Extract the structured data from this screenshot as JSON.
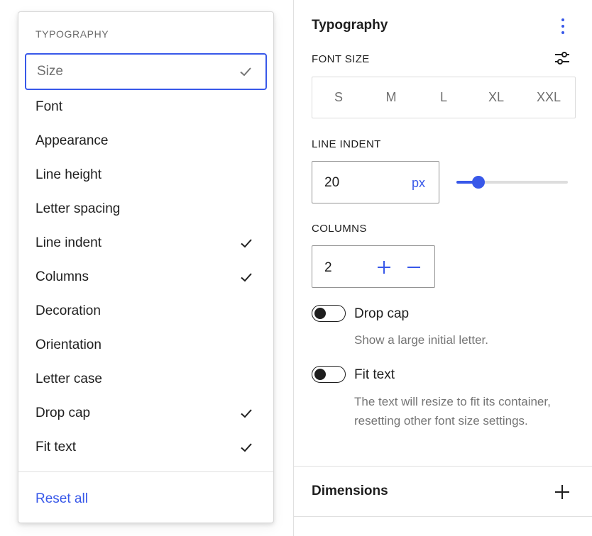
{
  "menu": {
    "heading": "TYPOGRAPHY",
    "items": [
      {
        "label": "Size",
        "checked": true,
        "focused": true
      },
      {
        "label": "Font",
        "checked": false
      },
      {
        "label": "Appearance",
        "checked": false
      },
      {
        "label": "Line height",
        "checked": false
      },
      {
        "label": "Letter spacing",
        "checked": false
      },
      {
        "label": "Line indent",
        "checked": true
      },
      {
        "label": "Columns",
        "checked": true
      },
      {
        "label": "Decoration",
        "checked": false
      },
      {
        "label": "Orientation",
        "checked": false
      },
      {
        "label": "Letter case",
        "checked": false
      },
      {
        "label": "Drop cap",
        "checked": true
      },
      {
        "label": "Fit text",
        "checked": true
      }
    ],
    "reset_label": "Reset all"
  },
  "panel": {
    "title": "Typography",
    "font_size": {
      "label": "FONT SIZE",
      "options": [
        "S",
        "M",
        "L",
        "XL",
        "XXL"
      ]
    },
    "line_indent": {
      "label": "LINE INDENT",
      "value": "20",
      "unit": "px",
      "slider_fraction": 0.2
    },
    "columns": {
      "label": "COLUMNS",
      "value": "2"
    },
    "drop_cap": {
      "label": "Drop cap",
      "help": "Show a large initial letter.",
      "enabled": false
    },
    "fit_text": {
      "label": "Fit text",
      "help": "The text will resize to fit its container, resetting other font size settings.",
      "enabled": false
    },
    "dimensions": {
      "title": "Dimensions"
    }
  },
  "colors": {
    "accent": "#3858e9",
    "text": "#1e1e1e",
    "muted": "#757575",
    "border": "#e0e0e0"
  },
  "icons": {
    "check": "check-icon",
    "more": "more-vertical-icon",
    "settings": "sliders-icon",
    "plus": "plus-icon",
    "minus": "minus-icon"
  }
}
